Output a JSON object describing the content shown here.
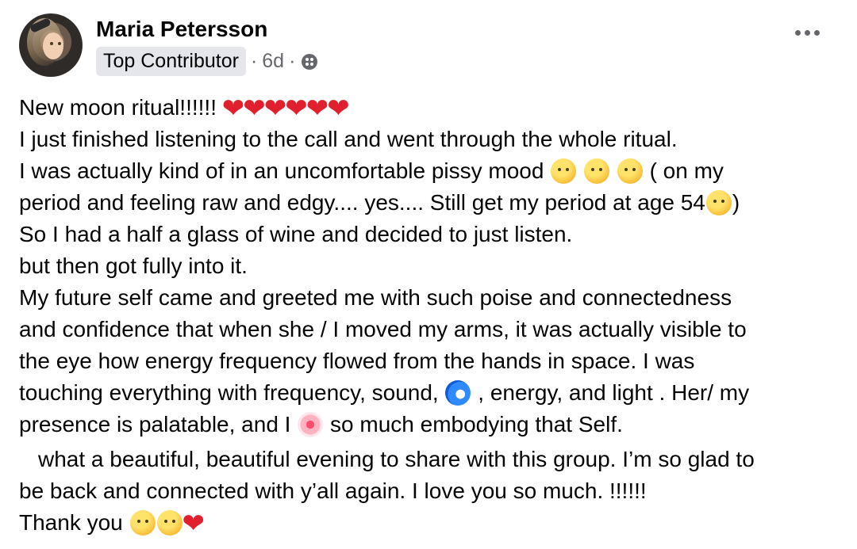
{
  "post": {
    "author": "Maria Petersson",
    "badge": "Top Contributor",
    "sep1": "·",
    "time": "6d",
    "sep2": "·",
    "lines": [
      "New moon ritual!!!!!!",
      "I just finished listening to the call and went through the whole ritual.",
      "I was actually kind of in an uncomfortable pissy mood",
      "( on my",
      "period and feeling raw and edgy....  yes.... Still get my period at age 54",
      ")",
      "So I had a half a glass of wine and decided to just listen.",
      "but then got fully into it.",
      "My future self came and greeted me with such poise and connectedness",
      "and confidence that when she / I moved my arms, it was actually visible to",
      "the eye how energy frequency flowed from the hands in space. I was",
      "touching everything with frequency, sound,",
      ", energy, and light . Her/ my",
      "presence is palatable, and I",
      "so much embodying that Self.",
      "what a beautiful, beautiful evening to share with this group. I’m so glad to",
      "be back and connected with y’all again. I love you so much. !!!!!!",
      "Thank you"
    ],
    "icons": {
      "globe": "globe-icon",
      "more": "more-options-icon",
      "hearts": "red-heart-emoji",
      "mood_emojis": [
        "thinking-face-emoji",
        "raised-eyebrow-emoji",
        "steam-from-nose-emoji"
      ],
      "eyeroll": "face-with-rolling-eyes-emoji",
      "wave": "water-wave-emoji",
      "heart_pulse": "growing-heart-emoji",
      "thanks_emojis": [
        "smiling-face-emoji",
        "hugging-face-emoji",
        "red-heart-emoji"
      ]
    }
  }
}
